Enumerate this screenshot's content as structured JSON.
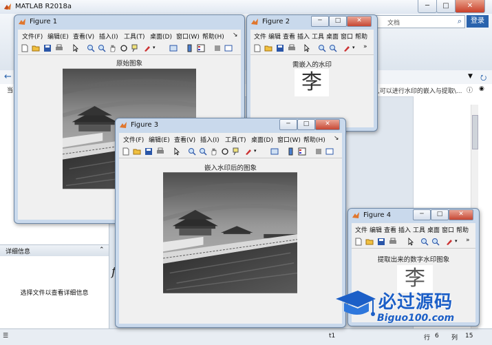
{
  "matlab": {
    "title": "MATLAB R2018a",
    "search_placeholder": "文档",
    "login": "登录",
    "hint": "是,可以进行水印的嵌入与提取\\...",
    "details_header": "详细信息",
    "details_text": "选择文件以查看详细信息",
    "cmd_char": "f",
    "status": {
      "label": "t1",
      "row_label": "行",
      "row": "6",
      "col_label": "列",
      "col": "15"
    }
  },
  "figure_menu": [
    "文件(F)",
    "编辑(E)",
    "查看(V)",
    "插入(I)",
    "工具(T)",
    "桌面(D)",
    "窗口(W)",
    "帮助(H)"
  ],
  "figure_menu_short": [
    "文件",
    "编辑",
    "查看",
    "插入",
    "工具",
    "桌面",
    "窗口",
    "帮助"
  ],
  "figures": {
    "fig1": {
      "title": "Figure 1",
      "image_title": "原始图象"
    },
    "fig2": {
      "title": "Figure 2",
      "image_title": "需嵌入的水印",
      "watermark_char": "李"
    },
    "fig3": {
      "title": "Figure 3",
      "image_title": "嵌入水印后的图象"
    },
    "fig4": {
      "title": "Figure 4",
      "image_title": "提取出来的数字水印图象",
      "watermark_char": "李"
    }
  },
  "brand": {
    "cn": "必过源码",
    "en": "Biguo100.com"
  },
  "colors": {
    "accent": "#2a63ad",
    "brand": "#1c5fc7"
  }
}
